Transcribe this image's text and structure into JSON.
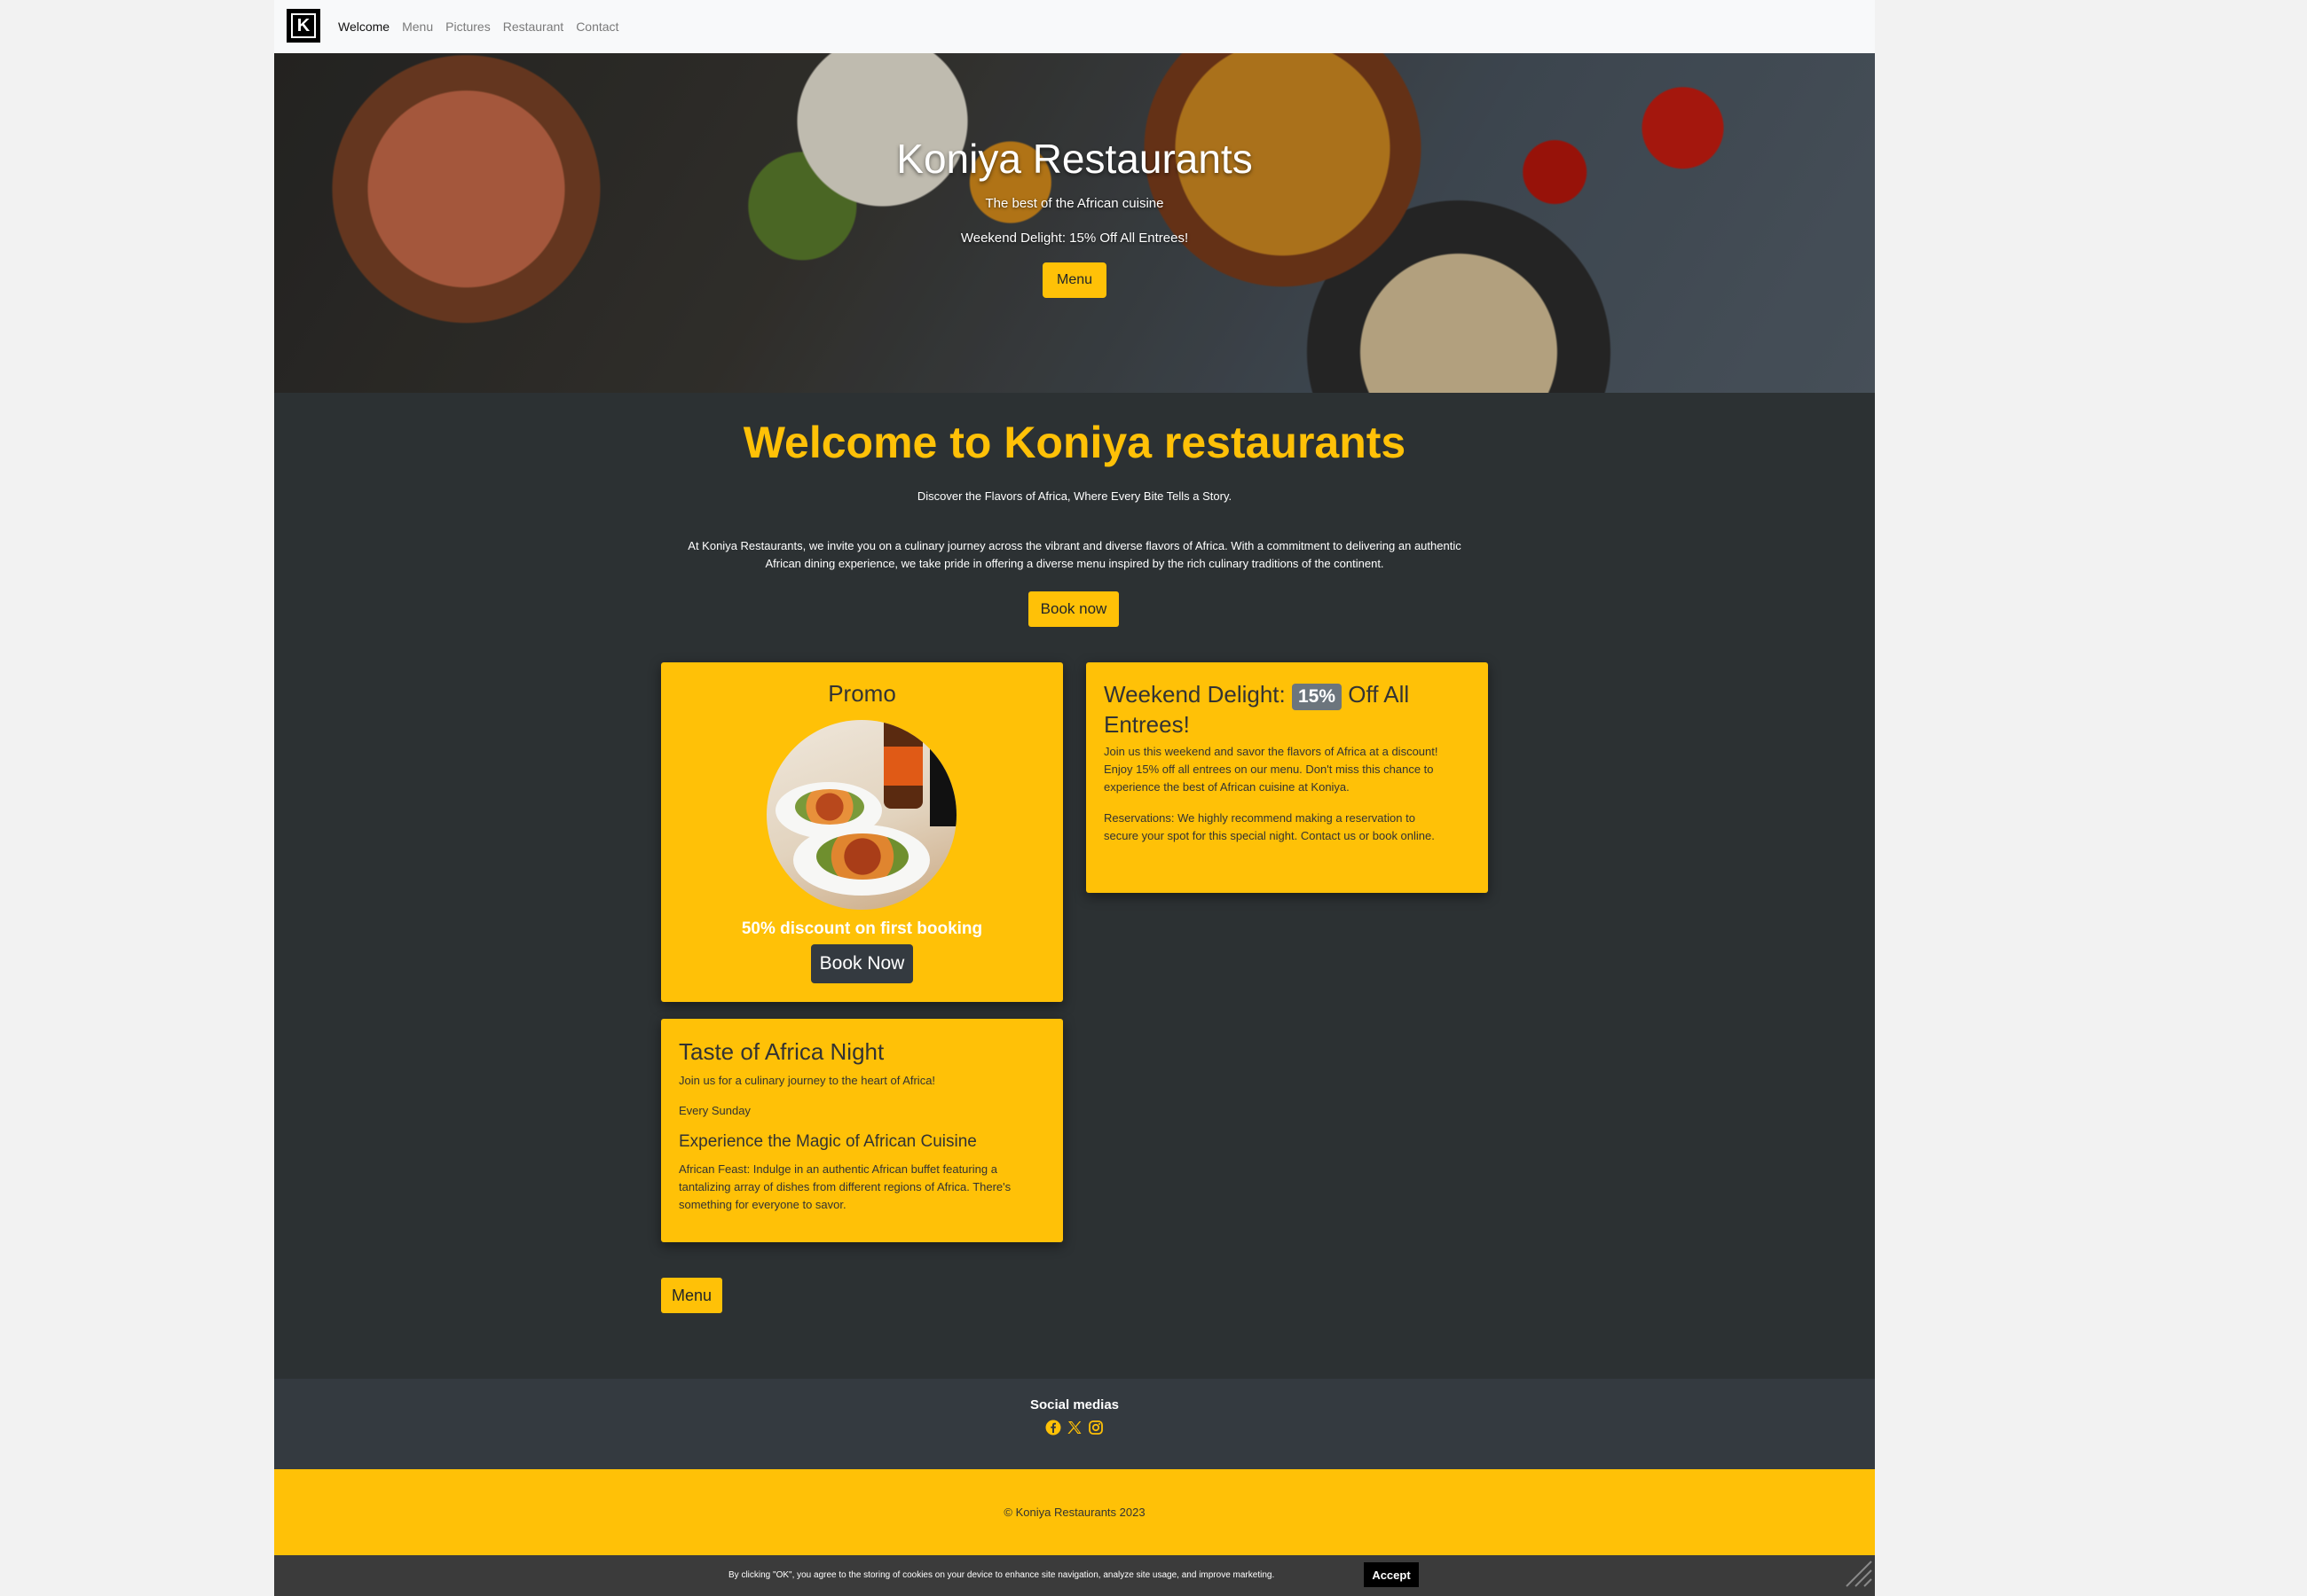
{
  "nav": {
    "logo_letter": "K",
    "links": [
      "Welcome",
      "Menu",
      "Pictures",
      "Restaurant",
      "Contact"
    ],
    "active": "Welcome"
  },
  "hero": {
    "title": "Koniya Restaurants",
    "subtitle": "The best of the African cuisine",
    "promo": "Weekend Delight: 15% Off All Entrees!",
    "button": "Menu"
  },
  "welcome": {
    "title": "Welcome to Koniya restaurants",
    "tagline": "Discover the Flavors of Africa, Where Every Bite Tells a Story.",
    "body": "At Koniya Restaurants, we invite you on a culinary journey across the vibrant and diverse flavors of Africa. With a commitment to delivering an authentic African dining experience, we take pride in offering a diverse menu inspired by the rich culinary traditions of the continent.",
    "button": "Book now"
  },
  "promo_card": {
    "title": "Promo",
    "discount": "50% discount on first booking",
    "button": "Book Now"
  },
  "weekend_card": {
    "title_before": "Weekend Delight:",
    "badge": "15%",
    "title_after": "Off All Entrees!",
    "paragraph1": "Join us this weekend and savor the flavors of Africa at a discount! Enjoy 15% off all entrees on our menu. Don't miss this chance to experience the best of African cuisine at Koniya.",
    "paragraph2": "Reservations: We highly recommend making a reservation to secure your spot for this special night. Contact us or book online."
  },
  "taste_card": {
    "title": "Taste of Africa Night",
    "intro": "Join us for a culinary journey to the heart of Africa!",
    "schedule": "Every Sunday",
    "subtitle": "Experience the Magic of African Cuisine",
    "body": "African Feast: Indulge in an authentic African buffet featuring a tantalizing array of dishes from different regions of Africa. There's something for everyone to savor."
  },
  "menu_button": "Menu",
  "footer": {
    "social_title": "Social medias",
    "social_icons": [
      "facebook-icon",
      "x-icon",
      "instagram-icon"
    ],
    "copyright": "© Koniya Restaurants 2023"
  },
  "cookie": {
    "text": "By clicking \"OK\", you agree to the storing of cookies on your device to enhance site navigation, analyze site usage, and improve marketing.",
    "button": "Accept"
  },
  "colors": {
    "accent": "#ffc107",
    "dark_bg": "#2c3133",
    "footer_bg": "#343a40",
    "badge": "#6c757d"
  }
}
